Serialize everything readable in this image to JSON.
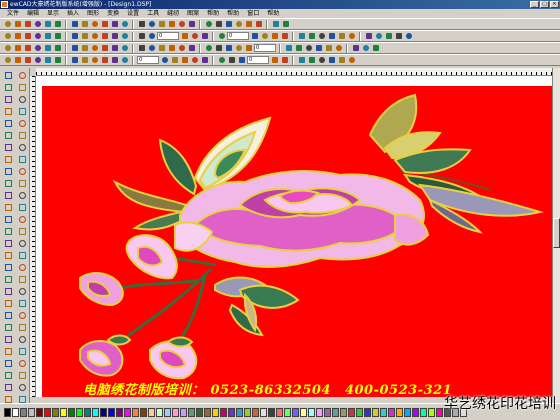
{
  "window": {
    "title": "ewCAD大豪绣花制版系统(增强版) - [Design1.DSP]",
    "min_label": "_",
    "max_label": "□",
    "close_label": "×"
  },
  "menu": [
    "文件",
    "编辑",
    "显示",
    "插入",
    "图形",
    "变换",
    "设置",
    "工具",
    "缝纫",
    "图案",
    "帮助",
    "帮助",
    "窗口",
    "帮助"
  ],
  "toolbar": {
    "field1": "0",
    "field2": "0",
    "field3": "0",
    "field4": "0",
    "field5": "0",
    "field6": "0"
  },
  "overlay": {
    "ad_title": "电脑绣花制版培训：",
    "phone1": "0523-86332504",
    "phone2": "400-0523-321",
    "watermark": "华艺绣花印花培训"
  },
  "palette_colors": [
    "#000000",
    "#ffffff",
    "#808080",
    "#c0c0c0",
    "#800000",
    "#ff0000",
    "#808000",
    "#ffff00",
    "#008000",
    "#00ff00",
    "#008080",
    "#00ffff",
    "#000080",
    "#0000ff",
    "#800080",
    "#ff00ff",
    "#ff8040",
    "#804000",
    "#ffcc99",
    "#ccffcc",
    "#99ccff",
    "#ff99cc",
    "#cc99ff",
    "#669966",
    "#336633",
    "#996633",
    "#ffcc00",
    "#cc0066",
    "#6633cc",
    "#3399cc",
    "#99cc33",
    "#cc6633",
    "#e0e0e0",
    "#404040",
    "#ff6666",
    "#66ff66",
    "#6666ff",
    "#ffff99",
    "#99ffff",
    "#ff99ff",
    "#996699",
    "#669999",
    "#999966",
    "#cc3333",
    "#33cc33",
    "#3333cc",
    "#cccc33",
    "#33cccc",
    "#cc33cc",
    "#ffaa00",
    "#00aaff",
    "#aa00ff",
    "#00ffaa",
    "#aaff00",
    "#ff00aa",
    "#555555",
    "#aaaaaa",
    "#dddddd"
  ],
  "colors": {
    "fabric": "#ff0000",
    "leaf_dark": "#2f6b4a",
    "leaf_light": "#9ec7a0",
    "petal_pink": "#e040c0",
    "petal_light": "#f8c8f0",
    "outline_gold": "#e8d040"
  }
}
